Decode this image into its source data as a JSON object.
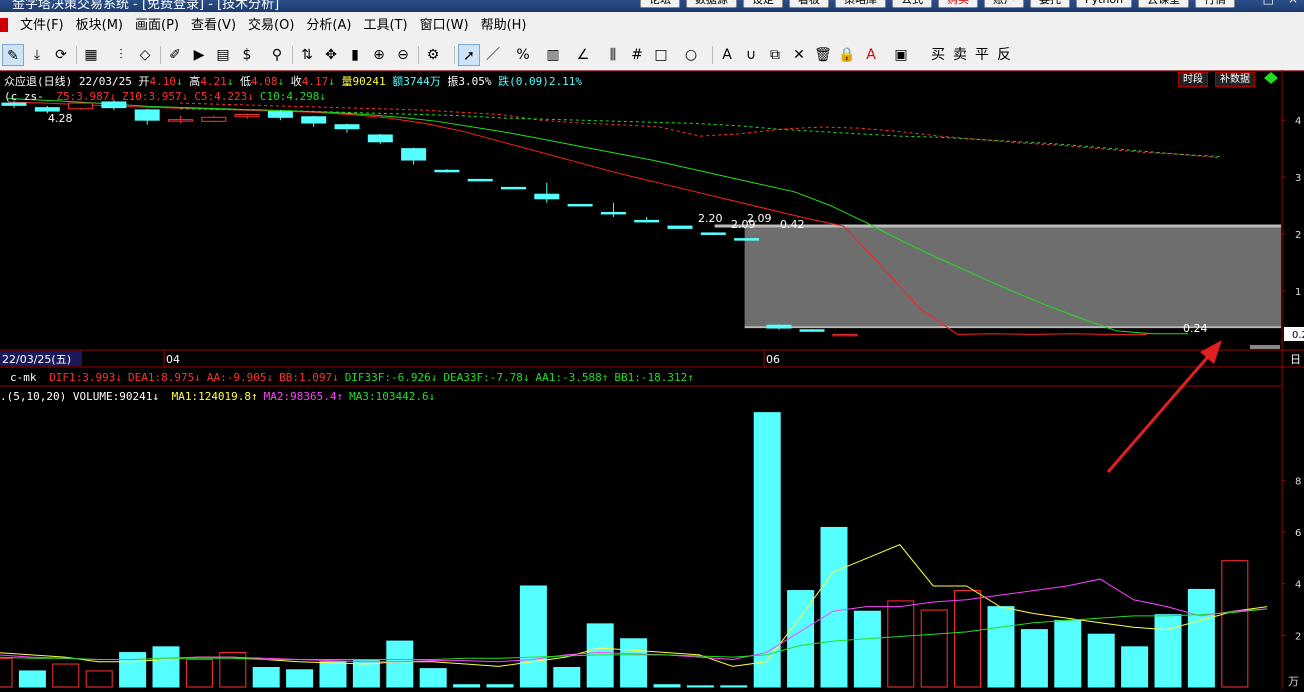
{
  "window": {
    "title": "金字塔决策交易系统 - [免费登录] - [技术分析]",
    "top_buttons": [
      "论坛",
      "数据源",
      "设定",
      "看板",
      "策略库",
      "公式",
      "购买",
      "账户",
      "委托",
      "Python",
      "云课堂",
      "行情"
    ],
    "controls": [
      "–",
      "□",
      "×"
    ]
  },
  "menu": [
    "文件(F)",
    "板块(M)",
    "画面(P)",
    "查看(V)",
    "交易(O)",
    "分析(A)",
    "工具(T)",
    "窗口(W)",
    "帮助(H)"
  ],
  "toolbar_icons": [
    "pencil-icon",
    "download-icon",
    "refresh-icon",
    "grid-icon",
    "candles-icon",
    "diamond-icon",
    "edit-icon",
    "play-icon",
    "doc-icon",
    "dollar-icon",
    "filter-icon",
    "compare-icon",
    "move-icon",
    "bar-icon",
    "zoom-in-icon",
    "zoom-out-icon",
    "gear-icon",
    "cursor-icon",
    "line-icon",
    "percent-icon",
    "ruler-icon",
    "angle-icon",
    "channel-icon",
    "hash-icon",
    "rect-icon",
    "circle-icon",
    "text-A-icon",
    "magnet-icon",
    "copy-icon",
    "delete-icon",
    "trash-icon",
    "lock-icon",
    "color-A-icon",
    "save-icon"
  ],
  "toolbar_text_buttons": [
    "买",
    "卖",
    "平",
    "反"
  ],
  "quote": {
    "name": "众应退(日线)",
    "date": "22/03/25",
    "open_label": "开",
    "open": "4.10",
    "high_label": "高",
    "high": "4.21",
    "low_label": "低",
    "low": "4.08",
    "close_label": "收",
    "close": "4.17",
    "vol_label": "量",
    "vol": "90241",
    "amt_label": "额",
    "amt": "3744万",
    "amp_label": "振",
    "amp": "3.05%",
    "chg_label": "跌",
    "chg": "(0.09)",
    "chg_pct": "2.11%"
  },
  "ma_line": {
    "prefix": "(c  zs-",
    "items": [
      {
        "text": "Z5:3.987↓",
        "color": "#ff3030"
      },
      {
        "text": "Z10:3.957↓",
        "color": "#ff3030"
      },
      {
        "text": "C5:4.223↓",
        "color": "#ff3030"
      },
      {
        "text": "C10:4.298↓",
        "color": "#22dd22"
      }
    ]
  },
  "right_buttons": [
    "时段",
    "补数据"
  ],
  "price_axis": [
    "4",
    "3",
    "2",
    "1"
  ],
  "price_labels": {
    "p1": "4.28",
    "p2": "2.20",
    "p3": "2.09",
    "p4": "2.09",
    "p5": "0.42",
    "p6": "0.24",
    "p7": "0.2"
  },
  "time_axis": {
    "cursor_date": "22/03/25(五)",
    "m1": "04",
    "m2": "06",
    "right": "日"
  },
  "macd_line": {
    "prefix": "c-mk",
    "items": [
      {
        "text": "DIF1:3.993↓",
        "color": "#ff3030"
      },
      {
        "text": "DEA1:8.975↓",
        "color": "#ff3030"
      },
      {
        "text": "AA:-9.905↓",
        "color": "#ff3030"
      },
      {
        "text": "BB:1.097↓",
        "color": "#ff3030"
      },
      {
        "text": "DIF33F:-6.926↓",
        "color": "#22dd22"
      },
      {
        "text": "DEA33F:-7.78↓",
        "color": "#22dd22"
      },
      {
        "text": "AA1:-3.588↑",
        "color": "#22dd22"
      },
      {
        "text": "BB1:-18.312↑",
        "color": "#22dd22"
      }
    ]
  },
  "vol_line": {
    "prefix": ".(5,10,20) VOLUME:90241↓",
    "items": [
      {
        "text": "MA1:124019.8↑",
        "color": "#ffff40"
      },
      {
        "text": "MA2:98365.4↑",
        "color": "#ff40ff"
      },
      {
        "text": "MA3:103442.6↓",
        "color": "#22dd22"
      }
    ]
  },
  "vol_axis": [
    "8",
    "6",
    "4",
    "2",
    "万"
  ],
  "colors": {
    "up": "#ff3030",
    "down": "#55ffff",
    "ma_green": "#22dd22",
    "ma_yellow": "#ffff40",
    "ma_magenta": "#ff40ff",
    "border": "#a00000"
  },
  "chart_data": {
    "type": "bar",
    "volume": [
      {
        "v": 25,
        "up": true
      },
      {
        "v": 14,
        "up": false
      },
      {
        "v": 20,
        "up": true
      },
      {
        "v": 14,
        "up": true
      },
      {
        "v": 30,
        "up": false
      },
      {
        "v": 35,
        "up": false
      },
      {
        "v": 24,
        "up": true
      },
      {
        "v": 30,
        "up": true
      },
      {
        "v": 17,
        "up": false
      },
      {
        "v": 15,
        "up": false
      },
      {
        "v": 22,
        "up": false
      },
      {
        "v": 23,
        "up": false
      },
      {
        "v": 40,
        "up": false
      },
      {
        "v": 16,
        "up": false
      },
      {
        "v": 2,
        "up": false
      },
      {
        "v": 2,
        "up": false
      },
      {
        "v": 88,
        "up": false
      },
      {
        "v": 17,
        "up": false
      },
      {
        "v": 55,
        "up": false
      },
      {
        "v": 42,
        "up": false
      },
      {
        "v": 2,
        "up": false
      },
      {
        "v": 1,
        "up": false
      },
      {
        "v": 1,
        "up": false
      },
      {
        "v": 239,
        "up": false
      },
      {
        "v": 84,
        "up": false
      },
      {
        "v": 139,
        "up": false
      },
      {
        "v": 66,
        "up": false
      },
      {
        "v": 75,
        "up": true
      },
      {
        "v": 67,
        "up": true
      },
      {
        "v": 84,
        "up": true
      },
      {
        "v": 70,
        "up": false
      },
      {
        "v": 50,
        "up": false
      },
      {
        "v": 58,
        "up": false
      },
      {
        "v": 46,
        "up": false
      },
      {
        "v": 35,
        "up": false
      },
      {
        "v": 63,
        "up": false
      },
      {
        "v": 85,
        "up": false
      },
      {
        "v": 110,
        "up": true
      }
    ],
    "vol_ylim": [
      0,
      250
    ],
    "ma_yellow": [
      30,
      28,
      26,
      22,
      22,
      24,
      26,
      26,
      24,
      22,
      21,
      20,
      22,
      22,
      20,
      18,
      22,
      26,
      34,
      32,
      30,
      28,
      18,
      22,
      60,
      100,
      112,
      124,
      88,
      88,
      70,
      64,
      60,
      56,
      52,
      50,
      58,
      66,
      70
    ],
    "ma_magenta": [
      28,
      26,
      25,
      24,
      24,
      25,
      26,
      26,
      25,
      24,
      23,
      22,
      22,
      23,
      23,
      22,
      24,
      28,
      30,
      29,
      28,
      26,
      24,
      30,
      48,
      66,
      70,
      70,
      74,
      76,
      80,
      84,
      88,
      94,
      76,
      70,
      62,
      66,
      68
    ],
    "ma_green": [
      26,
      25,
      25,
      24,
      24,
      25,
      25,
      25,
      24,
      24,
      24,
      24,
      24,
      24,
      25,
      25,
      26,
      27,
      28,
      28,
      28,
      27,
      26,
      28,
      36,
      40,
      42,
      44,
      46,
      48,
      52,
      56,
      58,
      60,
      62,
      62,
      63,
      65,
      68
    ],
    "price_ylim": [
      0,
      4.6
    ],
    "candles": [
      {
        "o": 4.3,
        "c": 4.26,
        "h": 4.33,
        "l": 4.22
      },
      {
        "o": 4.22,
        "c": 4.16,
        "h": 4.25,
        "l": 4.12
      },
      {
        "o": 4.2,
        "c": 4.3,
        "h": 4.33,
        "l": 4.18
      },
      {
        "o": 4.32,
        "c": 4.22,
        "h": 4.35,
        "l": 4.18
      },
      {
        "o": 4.18,
        "c": 4.0,
        "h": 4.2,
        "l": 3.92
      },
      {
        "o": 4.0,
        "c": 4.01,
        "h": 4.08,
        "l": 3.95
      },
      {
        "o": 3.98,
        "c": 4.05,
        "h": 4.08,
        "l": 3.96
      },
      {
        "o": 4.06,
        "c": 4.1,
        "h": 4.12,
        "l": 4.02
      },
      {
        "o": 4.15,
        "c": 4.05,
        "h": 4.18,
        "l": 4.0
      },
      {
        "o": 4.06,
        "c": 3.95,
        "h": 4.08,
        "l": 3.88
      },
      {
        "o": 3.92,
        "c": 3.85,
        "h": 3.94,
        "l": 3.78
      },
      {
        "o": 3.74,
        "c": 3.62,
        "h": 3.76,
        "l": 3.58
      },
      {
        "o": 3.5,
        "c": 3.3,
        "h": 3.52,
        "l": 3.22
      },
      {
        "o": 3.12,
        "c": 3.11,
        "h": 3.14,
        "l": 3.08
      },
      {
        "o": 2.96,
        "c": 2.95,
        "h": 2.97,
        "l": 2.94
      },
      {
        "o": 2.82,
        "c": 2.81,
        "h": 2.83,
        "l": 2.8
      },
      {
        "o": 2.7,
        "c": 2.62,
        "h": 2.9,
        "l": 2.55
      },
      {
        "o": 2.52,
        "c": 2.5,
        "h": 2.53,
        "l": 2.49
      },
      {
        "o": 2.38,
        "c": 2.36,
        "h": 2.55,
        "l": 2.3
      },
      {
        "o": 2.24,
        "c": 2.22,
        "h": 2.3,
        "l": 2.2
      },
      {
        "o": 2.14,
        "c": 2.1,
        "h": 2.14,
        "l": 2.09
      },
      {
        "o": 2.02,
        "c": 2.01,
        "h": 2.03,
        "l": 2.0
      },
      {
        "o": 1.92,
        "c": 1.91,
        "h": 1.93,
        "l": 1.9
      },
      {
        "o": 0.4,
        "c": 0.35,
        "h": 0.42,
        "l": 0.32
      },
      {
        "o": 0.32,
        "c": 0.3,
        "h": 0.33,
        "l": 0.29
      },
      {
        "o": 0.24,
        "c": 0.24,
        "h": 0.25,
        "l": 0.23
      }
    ],
    "gap_top": 2.09,
    "gap_bottom": 0.42
  }
}
